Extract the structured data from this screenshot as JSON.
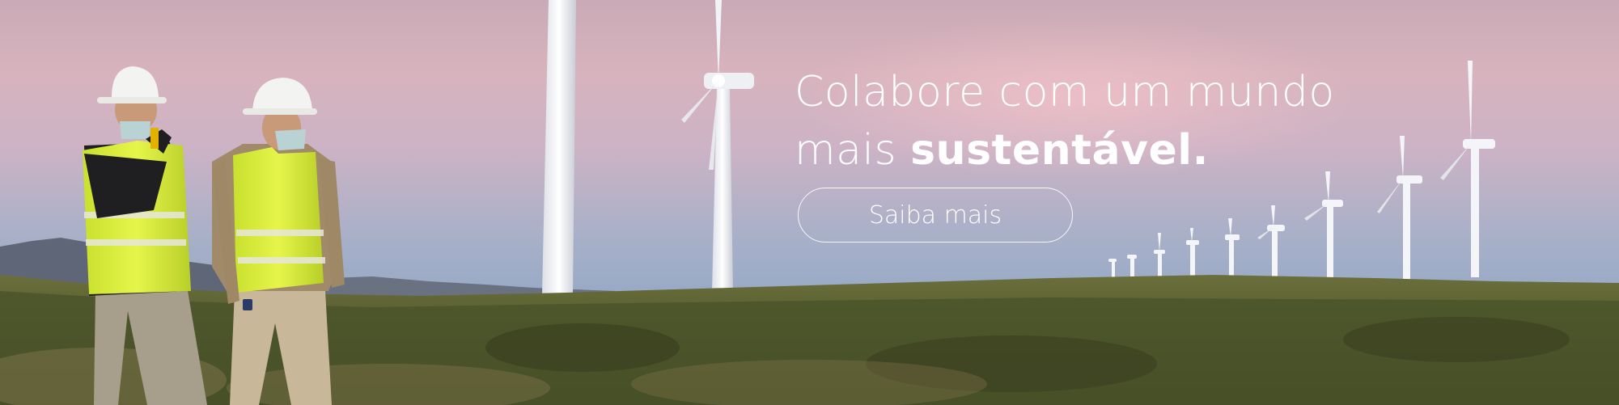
{
  "hero": {
    "headline_line1": "Colabore com um mundo",
    "headline_line2_prefix": "mais ",
    "headline_line2_emphasis": "sustentável.",
    "cta_label": "Saiba mais"
  },
  "colors": {
    "sky_top": "#c9aab6",
    "sky_bottom": "#8ea1bd",
    "vest": "#d9ee3a",
    "grass": "#4f5a2f",
    "text": "#ffffff"
  }
}
